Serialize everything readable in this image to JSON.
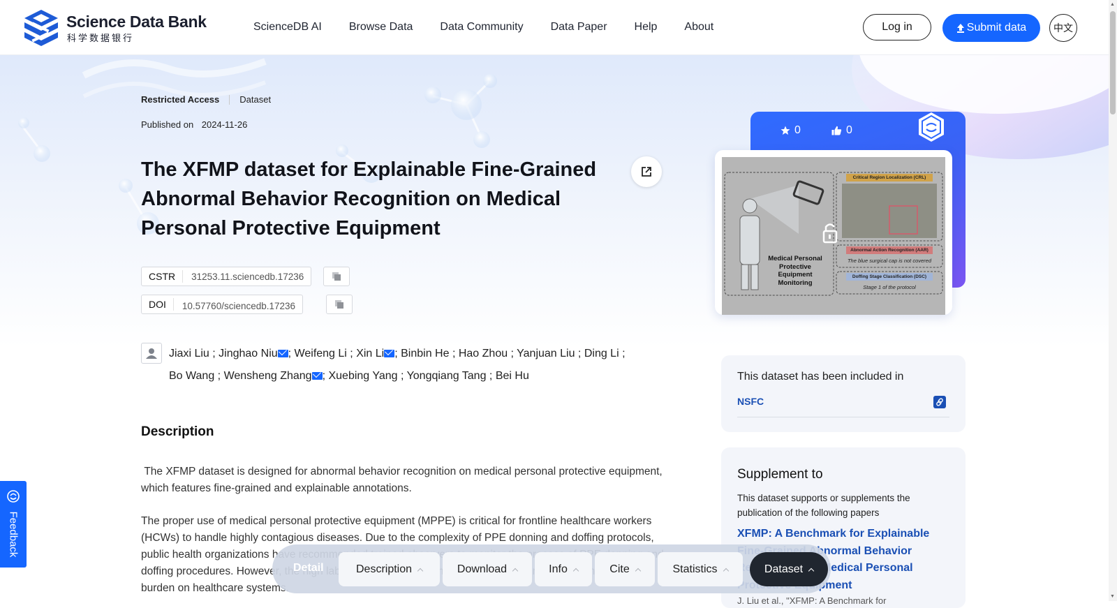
{
  "header": {
    "logo_en": "Science Data Bank",
    "logo_cn": "科学数据银行",
    "nav": [
      "ScienceDB AI",
      "Browse Data",
      "Data Community",
      "Data Paper",
      "Help",
      "About"
    ],
    "login_label": "Log in",
    "submit_label": "Submit data",
    "lang_label": "中文"
  },
  "dataset": {
    "access": "Restricted Access",
    "type": "Dataset",
    "published_label": "Published on",
    "published_date": "2024-11-26",
    "title": "The XFMP dataset for Explainable Fine-Grained Abnormal Behavior Recognition on Medical Personal Protective Equipment",
    "cstr_label": "CSTR",
    "cstr_value": "31253.11.sciencedb.17236",
    "doi_label": "DOI",
    "doi_value": "10.57760/sciencedb.17236",
    "authors": [
      {
        "name": "Jiaxi Liu",
        "mail": false
      },
      {
        "name": "Jinghao Niu",
        "mail": true
      },
      {
        "name": "Weifeng Li",
        "mail": false
      },
      {
        "name": "Xin Li",
        "mail": true
      },
      {
        "name": "Binbin He",
        "mail": false
      },
      {
        "name": "Hao Zhou",
        "mail": false
      },
      {
        "name": "Yanjuan Liu",
        "mail": false
      },
      {
        "name": "Ding Li",
        "mail": false
      },
      {
        "name": "Bo Wang",
        "mail": false
      },
      {
        "name": "Wensheng Zhang",
        "mail": true
      },
      {
        "name": "Xuebing Yang",
        "mail": false
      },
      {
        "name": "Yongqiang Tang",
        "mail": false
      },
      {
        "name": "Bei Hu",
        "mail": false
      }
    ]
  },
  "description": {
    "heading": "Description",
    "para1": " The XFMP dataset is designed for abnormal behavior recognition on medical personal protective equipment, which features fine-grained and explainable annotations.",
    "para2": "The proper use of medical personal protective equipment (MPPE) is critical for frontline healthcare workers (HCWs) to handle highly contagious diseases. Due to the complexity of PPE donning and doffing protocols, public health organizations have recommended trained observers to monitor the process of PPE donning and doffing procedures. However, the high labor and time costs of manual monitoring impose an unbearable burden on healthcare systems."
  },
  "stats": {
    "stars": "0",
    "likes": "0"
  },
  "cover": {
    "crl": "Critical Region Localization (CRL)",
    "aar": "Abnormal Action Recognition (AAR)",
    "aar_text": "The blue surgical cap is not covered",
    "dsc": "Doffing Stage Classification (DSC)",
    "dsc_text": "Stage 1 of the protocol",
    "mppe_line1": "Medical Personal",
    "mppe_line2": "Protective",
    "mppe_line3": "Equipment",
    "mppe_line4": "Monitoring"
  },
  "included": {
    "text": "This dataset has been included in",
    "link": "NSFC"
  },
  "supplement": {
    "heading": "Supplement to",
    "text": "This dataset supports or supplements the publication of the following papers",
    "paper_title": "XFMP: A Benchmark for Explainable Fine-Grained Abnormal Behavior Recognition on Medical Personal Protective Equipment",
    "citation": "J. Liu et al., \"XFMP: A Benchmark for"
  },
  "feedback_label": "Feedback",
  "tabbar": {
    "detail": "Detail",
    "tabs": [
      "Description",
      "Download",
      "Info",
      "Cite",
      "Statistics",
      "Dataset"
    ]
  },
  "colors": {
    "brand_blue": "#1566ff",
    "link_blue": "#1a4fb4",
    "active_tab": "#20262f"
  }
}
